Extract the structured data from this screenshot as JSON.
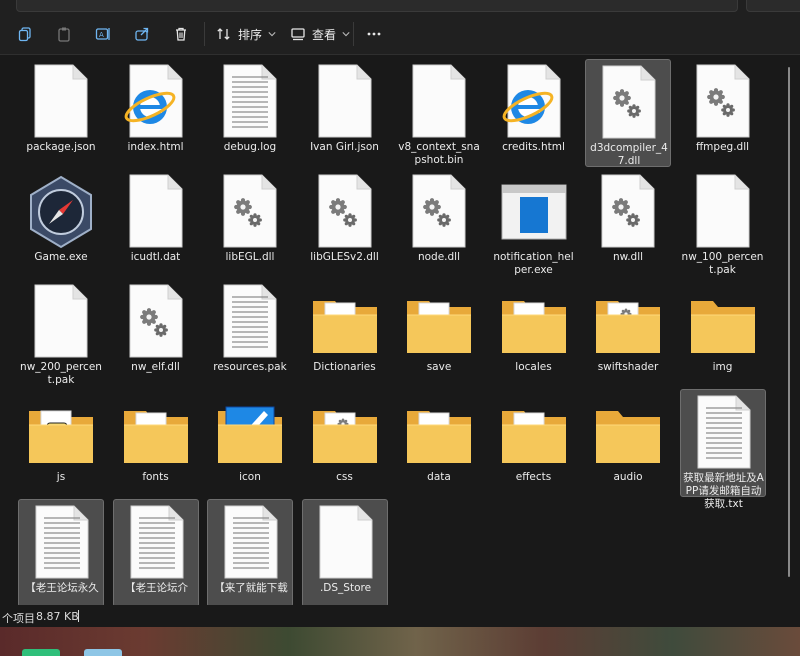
{
  "toolbar": {
    "sort_label": "排序",
    "view_label": "查看"
  },
  "files": [
    {
      "name": "package.json",
      "icon": "blank-file-icon",
      "selected": false
    },
    {
      "name": "index.html",
      "icon": "ie-html-icon",
      "selected": false
    },
    {
      "name": "debug.log",
      "icon": "text-file-icon",
      "selected": false
    },
    {
      "name": "Ivan Girl.json",
      "icon": "blank-file-icon",
      "selected": false
    },
    {
      "name": "v8_context_snapshot.bin",
      "icon": "blank-file-icon",
      "selected": false
    },
    {
      "name": "credits.html",
      "icon": "ie-html-icon",
      "selected": false
    },
    {
      "name": "d3dcompiler_47.dll",
      "icon": "dll-gear-icon",
      "selected": true
    },
    {
      "name": "ffmpeg.dll",
      "icon": "dll-gear-icon",
      "selected": false
    },
    {
      "name": "Game.exe",
      "icon": "compass-exe-icon",
      "selected": false
    },
    {
      "name": "icudtl.dat",
      "icon": "blank-file-icon",
      "selected": false
    },
    {
      "name": "libEGL.dll",
      "icon": "dll-gear-icon",
      "selected": false
    },
    {
      "name": "libGLESv2.dll",
      "icon": "dll-gear-icon",
      "selected": false
    },
    {
      "name": "node.dll",
      "icon": "dll-gear-icon",
      "selected": false
    },
    {
      "name": "notification_helper.exe",
      "icon": "app-window-icon",
      "selected": false
    },
    {
      "name": "nw.dll",
      "icon": "dll-gear-icon",
      "selected": false
    },
    {
      "name": "nw_100_percent.pak",
      "icon": "blank-file-icon",
      "selected": false
    },
    {
      "name": "nw_200_percent.pak",
      "icon": "blank-file-icon",
      "selected": false
    },
    {
      "name": "nw_elf.dll",
      "icon": "dll-gear-icon",
      "selected": false
    },
    {
      "name": "resources.pak",
      "icon": "text-file-icon",
      "selected": false
    },
    {
      "name": "Dictionaries",
      "icon": "folder-doc-icon",
      "selected": false
    },
    {
      "name": "save",
      "icon": "folder-doc-icon",
      "selected": false
    },
    {
      "name": "locales",
      "icon": "folder-doc-icon",
      "selected": false
    },
    {
      "name": "swiftshader",
      "icon": "folder-gear-icon",
      "selected": false
    },
    {
      "name": "img",
      "icon": "folder-icon",
      "selected": false
    },
    {
      "name": "js",
      "icon": "folder-js-icon",
      "selected": false
    },
    {
      "name": "fonts",
      "icon": "folder-doc-icon",
      "selected": false
    },
    {
      "name": "icon",
      "icon": "folder-image-icon",
      "selected": false
    },
    {
      "name": "css",
      "icon": "folder-gear-icon",
      "selected": false
    },
    {
      "name": "data",
      "icon": "folder-doc-icon",
      "selected": false
    },
    {
      "name": "effects",
      "icon": "folder-doc-icon",
      "selected": false
    },
    {
      "name": "audio",
      "icon": "folder-icon",
      "selected": false
    },
    {
      "name": "获取最新地址及APP请发邮箱自动获取.txt",
      "icon": "text-file-icon",
      "selected": true
    },
    {
      "name": "【老王论坛永久",
      "icon": "text-file-icon",
      "selected": true
    },
    {
      "name": "【老王论坛介",
      "icon": "text-file-icon",
      "selected": true
    },
    {
      "name": "【来了就能下载",
      "icon": "text-file-icon",
      "selected": true
    },
    {
      "name": ".DS_Store",
      "icon": "blank-file-icon",
      "selected": true
    }
  ],
  "status": {
    "count_text": "个项目",
    "size_text": "8.87 KB"
  }
}
